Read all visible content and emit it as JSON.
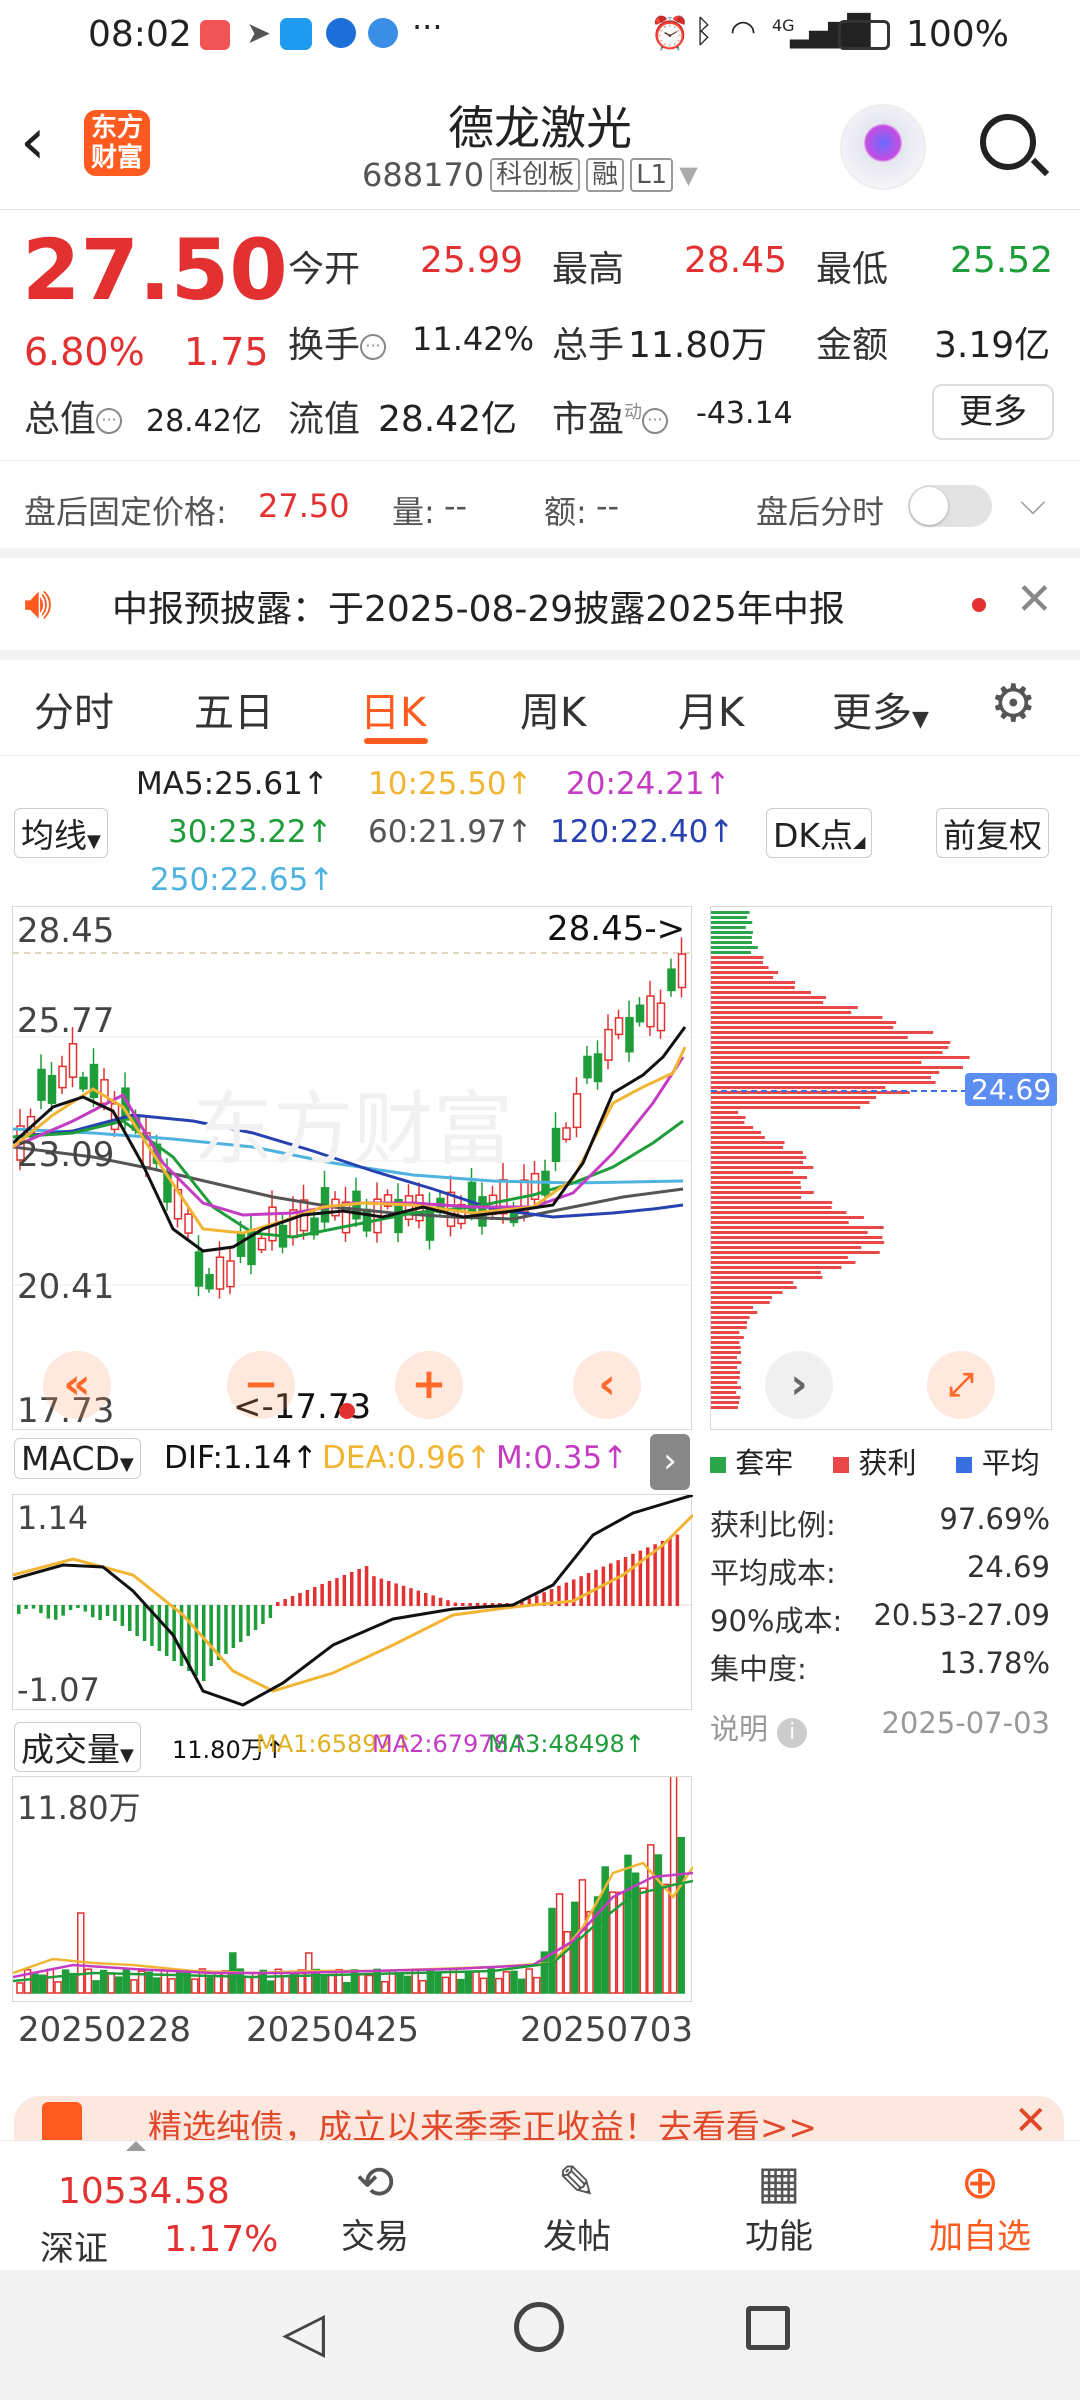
{
  "status": {
    "time": "08:02",
    "network": "4G",
    "battery": "100%"
  },
  "header": {
    "logo_line1": "东方",
    "logo_line2": "财富",
    "title": "德龙激光",
    "code": "688170",
    "board_tag": "科创板",
    "margin_tag": "融",
    "level_tag": "L1"
  },
  "quote": {
    "price": "27.50",
    "change_pct": "6.80%",
    "change": "1.75",
    "open_label": "今开",
    "open": "25.99",
    "high_label": "最高",
    "high": "28.45",
    "low_label": "最低",
    "low": "25.52",
    "turnover_label": "换手",
    "turnover": "11.42%",
    "volume_label": "总手",
    "volume": "11.80万",
    "amount_label": "金额",
    "amount": "3.19亿",
    "mktcap_label": "总值",
    "mktcap": "28.42亿",
    "float_label": "流值",
    "float": "28.42亿",
    "pe_label": "市盈",
    "pe_sup": "动",
    "pe": "-43.14",
    "more_button": "更多"
  },
  "afterhours": {
    "price_label": "盘后固定价格:",
    "price": "27.50",
    "vol_label": "量:",
    "vol": "--",
    "amt_label": "额:",
    "amt": "--",
    "timeshare_label": "盘后分时"
  },
  "notice": {
    "text": "中报预披露：于2025-08-29披露2025年中报"
  },
  "tabs": [
    "分时",
    "五日",
    "日K",
    "周K",
    "月K",
    "更多"
  ],
  "ma_panel": {
    "selector": "均线",
    "ma5": "MA5:25.61↑",
    "ma10": "10:25.50↑",
    "ma20": "20:24.21↑",
    "ma30": "30:23.22↑",
    "ma60": "60:21.97↑",
    "ma120": "120:22.40↑",
    "ma250": "250:22.65↑",
    "dk_button": "DK点",
    "adjust_button": "前复权"
  },
  "kline": {
    "y_labels": [
      "28.45",
      "25.77",
      "23.09",
      "20.41",
      "17.73"
    ],
    "high_marker": "28.45->",
    "low_marker": "<-17.73",
    "cost_marker": "24.69"
  },
  "macd": {
    "selector": "MACD",
    "dif": "DIF:1.14↑",
    "dea": "DEA:0.96↑",
    "m": "M:0.35↑",
    "y_top": "1.14",
    "y_bottom": "-1.07"
  },
  "volume": {
    "selector": "成交量",
    "v": "11.80万↑",
    "ma1": "MA1:65892↑",
    "ma2": "MA2:67978↑",
    "ma3": "MA3:48498↑",
    "y_top": "11.80万",
    "dates": [
      "20250228",
      "20250425",
      "20250703"
    ]
  },
  "chip": {
    "legend_trapped": "套牢",
    "legend_profit": "获利",
    "legend_avg": "平均",
    "profit_ratio_label": "获利比例:",
    "profit_ratio": "97.69%",
    "avg_cost_label": "平均成本:",
    "avg_cost": "24.69",
    "cost90_label": "90%成本:",
    "cost90": "20.53-27.09",
    "concentration_label": "集中度:",
    "concentration": "13.78%",
    "note_label": "说明",
    "date": "2025-07-03"
  },
  "banner": {
    "text": "精选纯债，成立以来季季正收益！去看看>>"
  },
  "bottom": {
    "index_value": "10534.58",
    "index_name": "深证",
    "index_pct": "1.17%",
    "trade": "交易",
    "post": "发帖",
    "func": "功能",
    "add": "加自选"
  },
  "colors": {
    "up": "#e33030",
    "down": "#1f9d3a",
    "accent": "#ff5a1f"
  }
}
